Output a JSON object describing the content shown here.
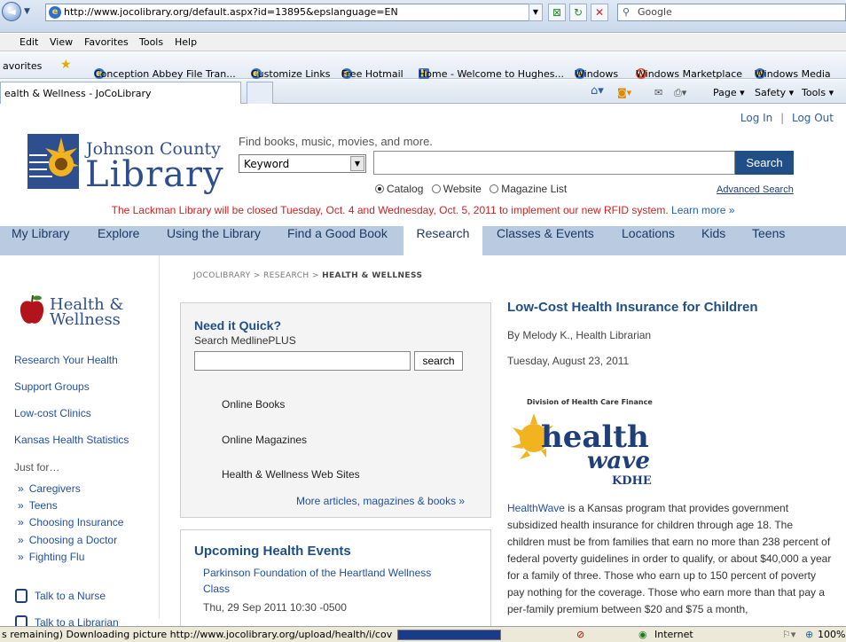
{
  "browser": {
    "url": "http://www.jocolibrary.org/default.aspx?id=13895&epslanguage=EN",
    "search_placeholder": "Google",
    "menu": [
      "Edit",
      "View",
      "Favorites",
      "Tools",
      "Help"
    ],
    "favorites_label": "avorites",
    "favorites": [
      "Conception Abbey File Tran...",
      "Customize Links",
      "Free Hotmail",
      "Home - Welcome to Hughes...",
      "Windows",
      "Windows Marketplace",
      "Windows Media"
    ],
    "tab_title": "ealth & Wellness - JoCoLibrary",
    "commands": [
      "Page ▾",
      "Safety ▾",
      "Tools ▾"
    ],
    "status_text": "s remaining) Downloading picture http://www.jocolibrary.org/upload/health/i/coverart/addiction",
    "progress": 1.0,
    "zone": "Internet",
    "zoom": "100%"
  },
  "header": {
    "login": "Log In",
    "separator": "|",
    "logout": "Log Out",
    "logo_line1": "Johnson County",
    "logo_line2": "Library",
    "find_text": "Find books, music, movies, and more.",
    "search_type": "Keyword",
    "search_button": "Search",
    "radio_catalog": "Catalog",
    "radio_website": "Website",
    "radio_magazine": "Magazine List",
    "advanced_search": "Advanced Search",
    "alert": "The Lackman Library will be closed Tuesday, Oct. 4 and Wednesday, Oct. 5, 2011 to implement our new RFID system.",
    "alert_link": "Learn more »"
  },
  "nav": [
    "My Library",
    "Explore",
    "Using the Library",
    "Find a Good Book",
    "Research",
    "Classes & Events",
    "Locations",
    "Kids",
    "Teens"
  ],
  "nav_active": "Research",
  "sidebar": {
    "heading1": "Health &",
    "heading2": "Wellness",
    "links": [
      "Research Your Health",
      "Support Groups",
      "Low-cost Clinics",
      "Kansas Health Statistics"
    ],
    "just_for": "Just for…",
    "sublinks": [
      "Caregivers",
      "Teens",
      "Choosing Insurance",
      "Choosing a Doctor",
      "Fighting Flu"
    ],
    "talk_nurse": "Talk to a Nurse",
    "talk_librarian": "Talk to a Librarian"
  },
  "breadcrumb": {
    "path": "JOCOLIBRARY > RESEARCH > ",
    "current": "HEALTH & WELLNESS"
  },
  "quick": {
    "title": "Need it Quick?",
    "subtitle": "Search MedlinePLUS",
    "button": "search",
    "links": [
      "Online Books",
      "Online Magazines",
      "Health & Wellness Web Sites"
    ],
    "more": "More articles, magazines & books »"
  },
  "events": {
    "title": "Upcoming Health Events",
    "link1": "Parkinson Foundation of the Heartland Wellness",
    "link2": "Class",
    "date": "Thu, 29 Sep 2011 10:30 -0500"
  },
  "article": {
    "title": "Low-Cost Health Insurance for Children",
    "byline": "By Melody K., Health Librarian",
    "date": "Tuesday, August 23, 2011",
    "logo_top": "Division of Health Care Finance",
    "logo_health": "health",
    "logo_wave": "wave",
    "logo_kdhe": "KDHE",
    "lead": "HealthWave",
    "body": " is a Kansas program that provides government subsidized health insurance for children through age 18. The children must be from families that earn no more than 238 percent of federal poverty guidelines in order to qualify, or about $40,000 a year for a family of three.  Those who earn up to 150 percent of poverty pay nothing for the coverage. Those who earn more than that pay a per-family premium between $20 and $75 a month,"
  }
}
